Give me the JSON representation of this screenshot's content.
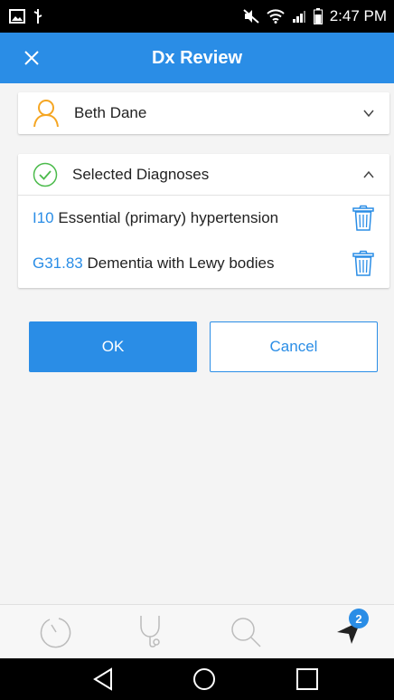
{
  "status_bar": {
    "time": "2:47 PM"
  },
  "header": {
    "title": "Dx Review"
  },
  "patient": {
    "name": "Beth Dane"
  },
  "diagnoses": {
    "title": "Selected Diagnoses",
    "items": [
      {
        "code": "I10",
        "description": "Essential (primary) hypertension"
      },
      {
        "code": "G31.83",
        "description": "Dementia with Lewy bodies"
      }
    ]
  },
  "actions": {
    "ok_label": "OK",
    "cancel_label": "Cancel"
  },
  "bottom_nav": {
    "badge_count": "2"
  },
  "colors": {
    "accent": "#2a8de6",
    "patient_icon": "#f5a623",
    "check_icon": "#4cbb4c"
  }
}
